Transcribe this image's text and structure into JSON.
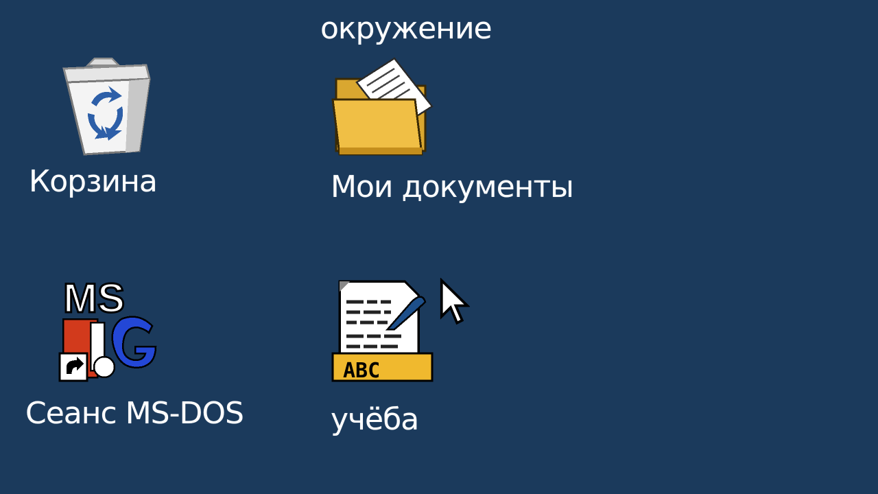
{
  "desktop": {
    "background_color": "#1b3a5c",
    "label_color": "#ffffff",
    "icons": [
      {
        "label": "окружение",
        "icon": "network-neighborhood-icon"
      },
      {
        "label": "Корзина",
        "icon": "recycle-bin-icon"
      },
      {
        "label": "Мои документы",
        "icon": "my-documents-folder-icon"
      },
      {
        "label": "Сеанс MS-DOS",
        "icon": "ms-dos-prompt-icon"
      },
      {
        "label": "учёба",
        "icon": "text-document-icon"
      }
    ]
  },
  "pointer": {
    "icon": "mouse-pointer-icon"
  }
}
